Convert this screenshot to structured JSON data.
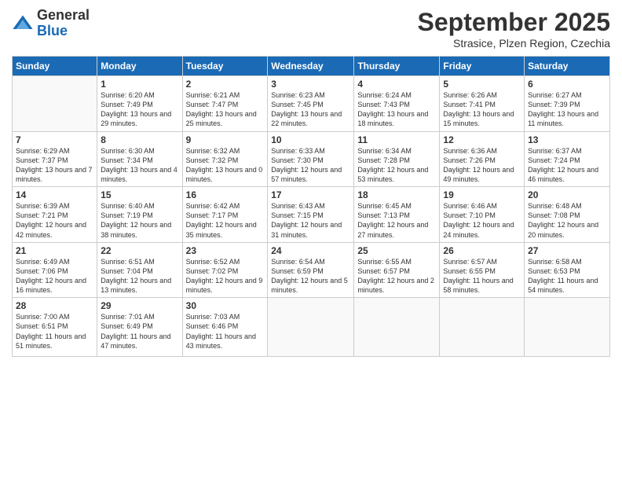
{
  "header": {
    "logo": {
      "general": "General",
      "blue": "Blue"
    },
    "title": "September 2025",
    "subtitle": "Strasice, Plzen Region, Czechia"
  },
  "weekdays": [
    "Sunday",
    "Monday",
    "Tuesday",
    "Wednesday",
    "Thursday",
    "Friday",
    "Saturday"
  ],
  "weeks": [
    [
      {
        "day": "",
        "empty": true
      },
      {
        "day": "1",
        "sunrise": "Sunrise: 6:20 AM",
        "sunset": "Sunset: 7:49 PM",
        "daylight": "Daylight: 13 hours and 29 minutes."
      },
      {
        "day": "2",
        "sunrise": "Sunrise: 6:21 AM",
        "sunset": "Sunset: 7:47 PM",
        "daylight": "Daylight: 13 hours and 25 minutes."
      },
      {
        "day": "3",
        "sunrise": "Sunrise: 6:23 AM",
        "sunset": "Sunset: 7:45 PM",
        "daylight": "Daylight: 13 hours and 22 minutes."
      },
      {
        "day": "4",
        "sunrise": "Sunrise: 6:24 AM",
        "sunset": "Sunset: 7:43 PM",
        "daylight": "Daylight: 13 hours and 18 minutes."
      },
      {
        "day": "5",
        "sunrise": "Sunrise: 6:26 AM",
        "sunset": "Sunset: 7:41 PM",
        "daylight": "Daylight: 13 hours and 15 minutes."
      },
      {
        "day": "6",
        "sunrise": "Sunrise: 6:27 AM",
        "sunset": "Sunset: 7:39 PM",
        "daylight": "Daylight: 13 hours and 11 minutes."
      }
    ],
    [
      {
        "day": "7",
        "sunrise": "Sunrise: 6:29 AM",
        "sunset": "Sunset: 7:37 PM",
        "daylight": "Daylight: 13 hours and 7 minutes."
      },
      {
        "day": "8",
        "sunrise": "Sunrise: 6:30 AM",
        "sunset": "Sunset: 7:34 PM",
        "daylight": "Daylight: 13 hours and 4 minutes."
      },
      {
        "day": "9",
        "sunrise": "Sunrise: 6:32 AM",
        "sunset": "Sunset: 7:32 PM",
        "daylight": "Daylight: 13 hours and 0 minutes."
      },
      {
        "day": "10",
        "sunrise": "Sunrise: 6:33 AM",
        "sunset": "Sunset: 7:30 PM",
        "daylight": "Daylight: 12 hours and 57 minutes."
      },
      {
        "day": "11",
        "sunrise": "Sunrise: 6:34 AM",
        "sunset": "Sunset: 7:28 PM",
        "daylight": "Daylight: 12 hours and 53 minutes."
      },
      {
        "day": "12",
        "sunrise": "Sunrise: 6:36 AM",
        "sunset": "Sunset: 7:26 PM",
        "daylight": "Daylight: 12 hours and 49 minutes."
      },
      {
        "day": "13",
        "sunrise": "Sunrise: 6:37 AM",
        "sunset": "Sunset: 7:24 PM",
        "daylight": "Daylight: 12 hours and 46 minutes."
      }
    ],
    [
      {
        "day": "14",
        "sunrise": "Sunrise: 6:39 AM",
        "sunset": "Sunset: 7:21 PM",
        "daylight": "Daylight: 12 hours and 42 minutes."
      },
      {
        "day": "15",
        "sunrise": "Sunrise: 6:40 AM",
        "sunset": "Sunset: 7:19 PM",
        "daylight": "Daylight: 12 hours and 38 minutes."
      },
      {
        "day": "16",
        "sunrise": "Sunrise: 6:42 AM",
        "sunset": "Sunset: 7:17 PM",
        "daylight": "Daylight: 12 hours and 35 minutes."
      },
      {
        "day": "17",
        "sunrise": "Sunrise: 6:43 AM",
        "sunset": "Sunset: 7:15 PM",
        "daylight": "Daylight: 12 hours and 31 minutes."
      },
      {
        "day": "18",
        "sunrise": "Sunrise: 6:45 AM",
        "sunset": "Sunset: 7:13 PM",
        "daylight": "Daylight: 12 hours and 27 minutes."
      },
      {
        "day": "19",
        "sunrise": "Sunrise: 6:46 AM",
        "sunset": "Sunset: 7:10 PM",
        "daylight": "Daylight: 12 hours and 24 minutes."
      },
      {
        "day": "20",
        "sunrise": "Sunrise: 6:48 AM",
        "sunset": "Sunset: 7:08 PM",
        "daylight": "Daylight: 12 hours and 20 minutes."
      }
    ],
    [
      {
        "day": "21",
        "sunrise": "Sunrise: 6:49 AM",
        "sunset": "Sunset: 7:06 PM",
        "daylight": "Daylight: 12 hours and 16 minutes."
      },
      {
        "day": "22",
        "sunrise": "Sunrise: 6:51 AM",
        "sunset": "Sunset: 7:04 PM",
        "daylight": "Daylight: 12 hours and 13 minutes."
      },
      {
        "day": "23",
        "sunrise": "Sunrise: 6:52 AM",
        "sunset": "Sunset: 7:02 PM",
        "daylight": "Daylight: 12 hours and 9 minutes."
      },
      {
        "day": "24",
        "sunrise": "Sunrise: 6:54 AM",
        "sunset": "Sunset: 6:59 PM",
        "daylight": "Daylight: 12 hours and 5 minutes."
      },
      {
        "day": "25",
        "sunrise": "Sunrise: 6:55 AM",
        "sunset": "Sunset: 6:57 PM",
        "daylight": "Daylight: 12 hours and 2 minutes."
      },
      {
        "day": "26",
        "sunrise": "Sunrise: 6:57 AM",
        "sunset": "Sunset: 6:55 PM",
        "daylight": "Daylight: 11 hours and 58 minutes."
      },
      {
        "day": "27",
        "sunrise": "Sunrise: 6:58 AM",
        "sunset": "Sunset: 6:53 PM",
        "daylight": "Daylight: 11 hours and 54 minutes."
      }
    ],
    [
      {
        "day": "28",
        "sunrise": "Sunrise: 7:00 AM",
        "sunset": "Sunset: 6:51 PM",
        "daylight": "Daylight: 11 hours and 51 minutes."
      },
      {
        "day": "29",
        "sunrise": "Sunrise: 7:01 AM",
        "sunset": "Sunset: 6:49 PM",
        "daylight": "Daylight: 11 hours and 47 minutes."
      },
      {
        "day": "30",
        "sunrise": "Sunrise: 7:03 AM",
        "sunset": "Sunset: 6:46 PM",
        "daylight": "Daylight: 11 hours and 43 minutes."
      },
      {
        "day": "",
        "empty": true
      },
      {
        "day": "",
        "empty": true
      },
      {
        "day": "",
        "empty": true
      },
      {
        "day": "",
        "empty": true
      }
    ]
  ]
}
